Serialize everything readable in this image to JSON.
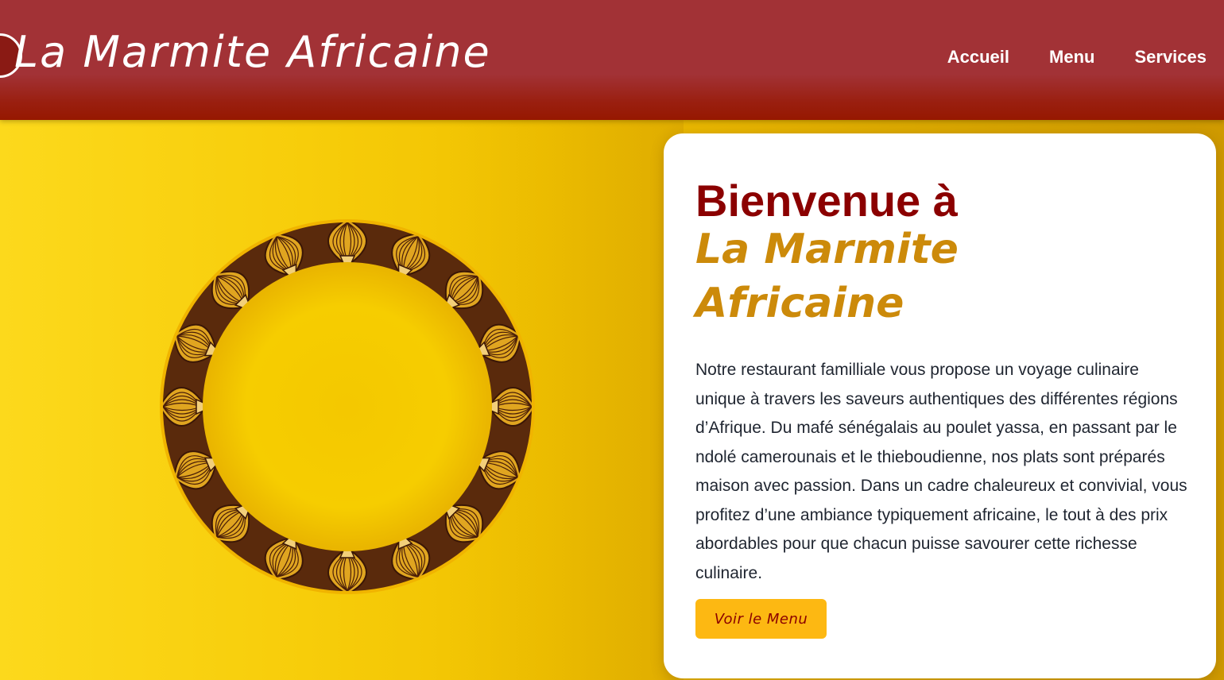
{
  "header": {
    "brand": "La Marmite Africaine",
    "nav": [
      {
        "label": "Accueil"
      },
      {
        "label": "Menu"
      },
      {
        "label": "Services"
      }
    ]
  },
  "hero": {
    "image_icon": "mandala-plate-icon",
    "card": {
      "title_line": "Bienvenue à",
      "title_brand": "La Marmite Africaine",
      "description": "Notre restaurant familliale vous propose un voyage culinaire unique à travers les saveurs authentiques des différentes régions d’Afrique. Du mafé sénégalais au poulet yassa, en passant par le ndolé camerounais et le thieboudienne, nos plats sont préparés maison avec passion. Dans un cadre chaleureux et convivial, vous profitez d’une ambiance typiquement africaine, le tout à des prix abordables pour que chacun puisse savourer cette richesse culinaire.",
      "cta_label": "Voir le Menu"
    }
  },
  "colors": {
    "header_bg": "#a23236",
    "hero_bg": "#f5c800",
    "title": "#8b0000",
    "brand_accent": "#cc8a0a",
    "cta_bg": "#fdb812"
  }
}
